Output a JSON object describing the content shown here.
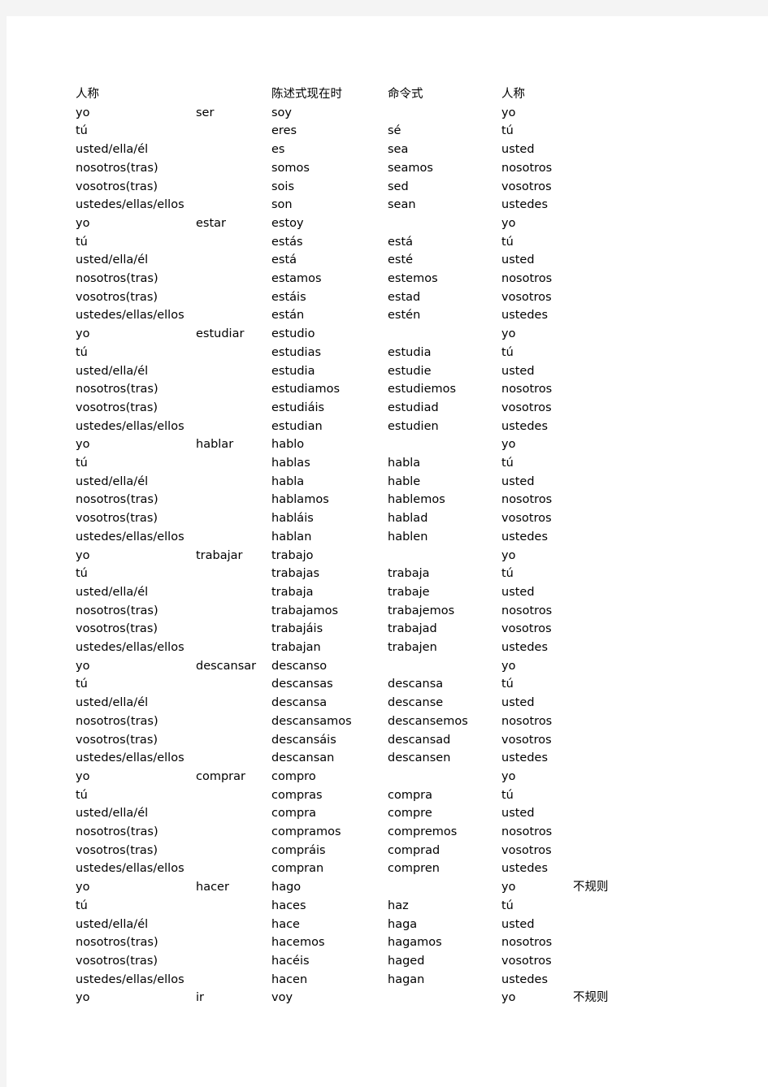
{
  "document": {
    "title": "Spanish verb conjugation table",
    "text_color": "#000000",
    "page_background": "#ffffff",
    "margin_background": "#f4f4f4"
  },
  "columns": {
    "person": "人称",
    "verb": "",
    "indicative_present": "陈述式现在时",
    "imperative": "命令式",
    "person2": "人称",
    "note": ""
  },
  "notes": {
    "irregular": "不规则"
  },
  "rows": [
    {
      "person": "人称",
      "verb": "",
      "indicative": "陈述式现在时",
      "imperative": "命令式",
      "person2": "人称",
      "note": ""
    },
    {
      "person": "yo",
      "verb": "ser",
      "indicative": "soy",
      "imperative": "",
      "person2": "yo",
      "note": ""
    },
    {
      "person": "tú",
      "verb": "",
      "indicative": "eres",
      "imperative": "sé",
      "person2": "tú",
      "note": ""
    },
    {
      "person": "usted/ella/él",
      "verb": "",
      "indicative": "es",
      "imperative": "sea",
      "person2": "usted",
      "note": ""
    },
    {
      "person": "nosotros(tras)",
      "verb": "",
      "indicative": "somos",
      "imperative": "seamos",
      "person2": "nosotros",
      "note": ""
    },
    {
      "person": "vosotros(tras)",
      "verb": "",
      "indicative": "sois",
      "imperative": "sed",
      "person2": "vosotros",
      "note": ""
    },
    {
      "person": "ustedes/ellas/ellos",
      "verb": "",
      "indicative": "son",
      "imperative": "sean",
      "person2": "ustedes",
      "note": ""
    },
    {
      "person": "yo",
      "verb": "estar",
      "indicative": "estoy",
      "imperative": "",
      "person2": "yo",
      "note": ""
    },
    {
      "person": "tú",
      "verb": "",
      "indicative": "estás",
      "imperative": "está",
      "person2": "tú",
      "note": ""
    },
    {
      "person": "usted/ella/él",
      "verb": "",
      "indicative": "está",
      "imperative": "esté",
      "person2": "usted",
      "note": ""
    },
    {
      "person": "nosotros(tras)",
      "verb": "",
      "indicative": "estamos",
      "imperative": "estemos",
      "person2": "nosotros",
      "note": ""
    },
    {
      "person": "vosotros(tras)",
      "verb": "",
      "indicative": "estáis",
      "imperative": "estad",
      "person2": "vosotros",
      "note": ""
    },
    {
      "person": "ustedes/ellas/ellos",
      "verb": "",
      "indicative": "están",
      "imperative": "estén",
      "person2": "ustedes",
      "note": ""
    },
    {
      "person": "yo",
      "verb": "estudiar",
      "indicative": "estudio",
      "imperative": "",
      "person2": "yo",
      "note": ""
    },
    {
      "person": "tú",
      "verb": "",
      "indicative": "estudias",
      "imperative": "estudia",
      "person2": "tú",
      "note": ""
    },
    {
      "person": "usted/ella/él",
      "verb": "",
      "indicative": "estudia",
      "imperative": "estudie",
      "person2": "usted",
      "note": ""
    },
    {
      "person": "nosotros(tras)",
      "verb": "",
      "indicative": "estudiamos",
      "imperative": "estudiemos",
      "person2": "nosotros",
      "note": ""
    },
    {
      "person": "vosotros(tras)",
      "verb": "",
      "indicative": "estudiáis",
      "imperative": "estudiad",
      "person2": "vosotros",
      "note": ""
    },
    {
      "person": "ustedes/ellas/ellos",
      "verb": "",
      "indicative": "estudian",
      "imperative": "estudien",
      "person2": "ustedes",
      "note": ""
    },
    {
      "person": "yo",
      "verb": "hablar",
      "indicative": "hablo",
      "imperative": "",
      "person2": "yo",
      "note": ""
    },
    {
      "person": "tú",
      "verb": "",
      "indicative": "hablas",
      "imperative": "habla",
      "person2": "tú",
      "note": ""
    },
    {
      "person": "usted/ella/él",
      "verb": "",
      "indicative": "habla",
      "imperative": "hable",
      "person2": "usted",
      "note": ""
    },
    {
      "person": "nosotros(tras)",
      "verb": "",
      "indicative": "hablamos",
      "imperative": "hablemos",
      "person2": "nosotros",
      "note": ""
    },
    {
      "person": "vosotros(tras)",
      "verb": "",
      "indicative": "habláis",
      "imperative": "hablad",
      "person2": "vosotros",
      "note": ""
    },
    {
      "person": "ustedes/ellas/ellos",
      "verb": "",
      "indicative": "hablan",
      "imperative": "hablen",
      "person2": "ustedes",
      "note": ""
    },
    {
      "person": "yo",
      "verb": "trabajar",
      "indicative": "trabajo",
      "imperative": "",
      "person2": "yo",
      "note": ""
    },
    {
      "person": "tú",
      "verb": "",
      "indicative": "trabajas",
      "imperative": "trabaja",
      "person2": "tú",
      "note": ""
    },
    {
      "person": "usted/ella/él",
      "verb": "",
      "indicative": "trabaja",
      "imperative": "trabaje",
      "person2": "usted",
      "note": ""
    },
    {
      "person": "nosotros(tras)",
      "verb": "",
      "indicative": "trabajamos",
      "imperative": "trabajemos",
      "person2": "nosotros",
      "note": ""
    },
    {
      "person": "vosotros(tras)",
      "verb": "",
      "indicative": "trabajáis",
      "imperative": "trabajad",
      "person2": "vosotros",
      "note": ""
    },
    {
      "person": "ustedes/ellas/ellos",
      "verb": "",
      "indicative": "trabajan",
      "imperative": "trabajen",
      "person2": "ustedes",
      "note": ""
    },
    {
      "person": "yo",
      "verb": "descansar",
      "indicative": "descanso",
      "imperative": "",
      "person2": "yo",
      "note": ""
    },
    {
      "person": "tú",
      "verb": "",
      "indicative": "descansas",
      "imperative": "descansa",
      "person2": "tú",
      "note": ""
    },
    {
      "person": "usted/ella/él",
      "verb": "",
      "indicative": "descansa",
      "imperative": "descanse",
      "person2": "usted",
      "note": ""
    },
    {
      "person": "nosotros(tras)",
      "verb": "",
      "indicative": "descansamos",
      "imperative": "descansemos",
      "person2": "nosotros",
      "note": ""
    },
    {
      "person": "vosotros(tras)",
      "verb": "",
      "indicative": "descansáis",
      "imperative": "descansad",
      "person2": "vosotros",
      "note": ""
    },
    {
      "person": "ustedes/ellas/ellos",
      "verb": "",
      "indicative": "descansan",
      "imperative": "descansen",
      "person2": "ustedes",
      "note": ""
    },
    {
      "person": "yo",
      "verb": "comprar",
      "indicative": "compro",
      "imperative": "",
      "person2": "yo",
      "note": ""
    },
    {
      "person": "tú",
      "verb": "",
      "indicative": "compras",
      "imperative": "compra",
      "person2": "tú",
      "note": ""
    },
    {
      "person": "usted/ella/él",
      "verb": "",
      "indicative": "compra",
      "imperative": "compre",
      "person2": "usted",
      "note": ""
    },
    {
      "person": "nosotros(tras)",
      "verb": "",
      "indicative": "compramos",
      "imperative": "compremos",
      "person2": "nosotros",
      "note": ""
    },
    {
      "person": "vosotros(tras)",
      "verb": "",
      "indicative": "compráis",
      "imperative": "comprad",
      "person2": "vosotros",
      "note": ""
    },
    {
      "person": "ustedes/ellas/ellos",
      "verb": "",
      "indicative": "compran",
      "imperative": "compren",
      "person2": "ustedes",
      "note": ""
    },
    {
      "person": "yo",
      "verb": "hacer",
      "indicative": "hago",
      "imperative": "",
      "person2": "yo",
      "note": "不规则"
    },
    {
      "person": "tú",
      "verb": "",
      "indicative": "haces",
      "imperative": "haz",
      "person2": "tú",
      "note": ""
    },
    {
      "person": "usted/ella/él",
      "verb": "",
      "indicative": "hace",
      "imperative": "haga",
      "person2": "usted",
      "note": ""
    },
    {
      "person": "nosotros(tras)",
      "verb": "",
      "indicative": "hacemos",
      "imperative": "hagamos",
      "person2": "nosotros",
      "note": ""
    },
    {
      "person": "vosotros(tras)",
      "verb": "",
      "indicative": "hacéis",
      "imperative": "haged",
      "person2": "vosotros",
      "note": ""
    },
    {
      "person": "ustedes/ellas/ellos",
      "verb": "",
      "indicative": "hacen",
      "imperative": "hagan",
      "person2": "ustedes",
      "note": ""
    },
    {
      "person": "yo",
      "verb": "ir",
      "indicative": "voy",
      "imperative": "",
      "person2": "yo",
      "note": "不规则"
    }
  ]
}
